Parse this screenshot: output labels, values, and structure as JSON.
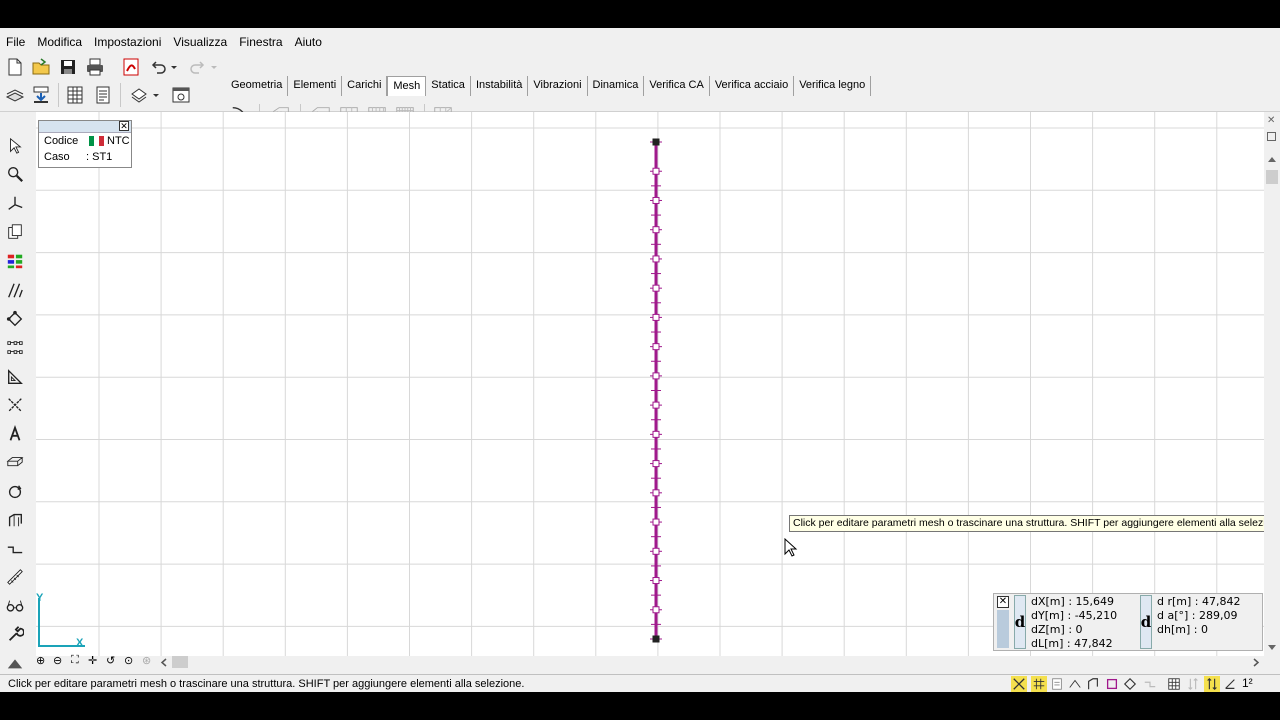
{
  "menu": [
    "File",
    "Modifica",
    "Impostazioni",
    "Visualizza",
    "Finestra",
    "Aiuto"
  ],
  "tabs": [
    {
      "label": "Geometria",
      "active": false
    },
    {
      "label": "Elementi",
      "active": false
    },
    {
      "label": "Carichi",
      "active": false
    },
    {
      "label": "Mesh",
      "active": true
    },
    {
      "label": "Statica",
      "active": false
    },
    {
      "label": "Instabilità",
      "active": false
    },
    {
      "label": "Vibrazioni",
      "active": false
    },
    {
      "label": "Dinamica",
      "active": false
    },
    {
      "label": "Verifica CA",
      "active": false
    },
    {
      "label": "Verifica acciaio",
      "active": false
    },
    {
      "label": "Verifica legno",
      "active": false
    }
  ],
  "legend": {
    "codice_label": "Codice",
    "codice_value": "NTC",
    "caso_label": "Caso",
    "caso_value": ": ST1"
  },
  "axes": {
    "x": "X",
    "y": "Y"
  },
  "tooltip": "Click per editare parametri mesh o trascinare una struttura. SHIFT per aggiungere elementi alla selezione.",
  "status": "Click per editare parametri mesh o trascinare una struttura. SHIFT per aggiungere elementi alla selezione.",
  "coords": {
    "dX": "dX[m] : 15,649",
    "dY": "dY[m] : -45,210",
    "dZ": "dZ[m] : 0",
    "dL": "dL[m] : 47,842",
    "dr": "d r[m] : 47,842",
    "da": "d a[°] : 289,09",
    "dh": "dh[m] : 0",
    "d_symbol": "d"
  },
  "colors": {
    "accent": "#a0198c",
    "grid": "#d8d8d8",
    "flag_green": "#009246",
    "flag_red": "#ce2b37"
  },
  "nodes_count_visible": 18,
  "statusbar_right": "1²"
}
